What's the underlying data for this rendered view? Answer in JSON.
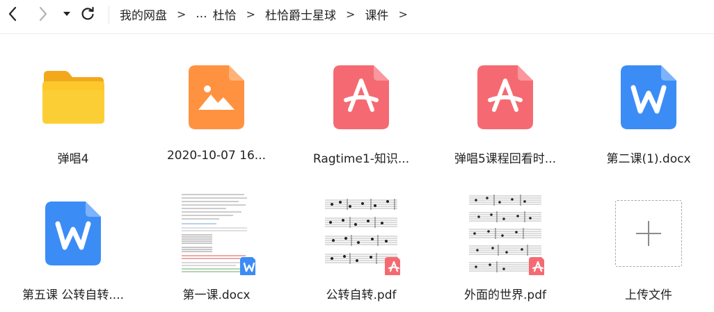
{
  "breadcrumb": {
    "items": [
      "我的网盘",
      "...",
      "杜恰",
      "杜恰爵士星球",
      "课件"
    ],
    "separator": ">"
  },
  "files": [
    {
      "name": "弹唱4",
      "type": "folder-icon"
    },
    {
      "name": "2020-10-07 16...",
      "type": "image-icon"
    },
    {
      "name": "Ragtime1-知识...",
      "type": "pdf-icon"
    },
    {
      "name": "弹唱5课程回看时...",
      "type": "pdf-icon"
    },
    {
      "name": "第二课(1).docx",
      "type": "word-icon"
    },
    {
      "name": "第五课 公转自转....",
      "type": "word-icon"
    },
    {
      "name": "第一课.docx",
      "type": "doc-thumbnail"
    },
    {
      "name": "公转自转.pdf",
      "type": "sheet-music-thumbnail"
    },
    {
      "name": "外面的世界.pdf",
      "type": "sheet-music-thumbnail"
    }
  ],
  "upload": {
    "label": "上传文件",
    "icon": "plus-icon"
  },
  "colors": {
    "folder": "#f7c21d",
    "image": "#ff8f3a",
    "pdf": "#f56a72",
    "word": "#3b8af5"
  }
}
